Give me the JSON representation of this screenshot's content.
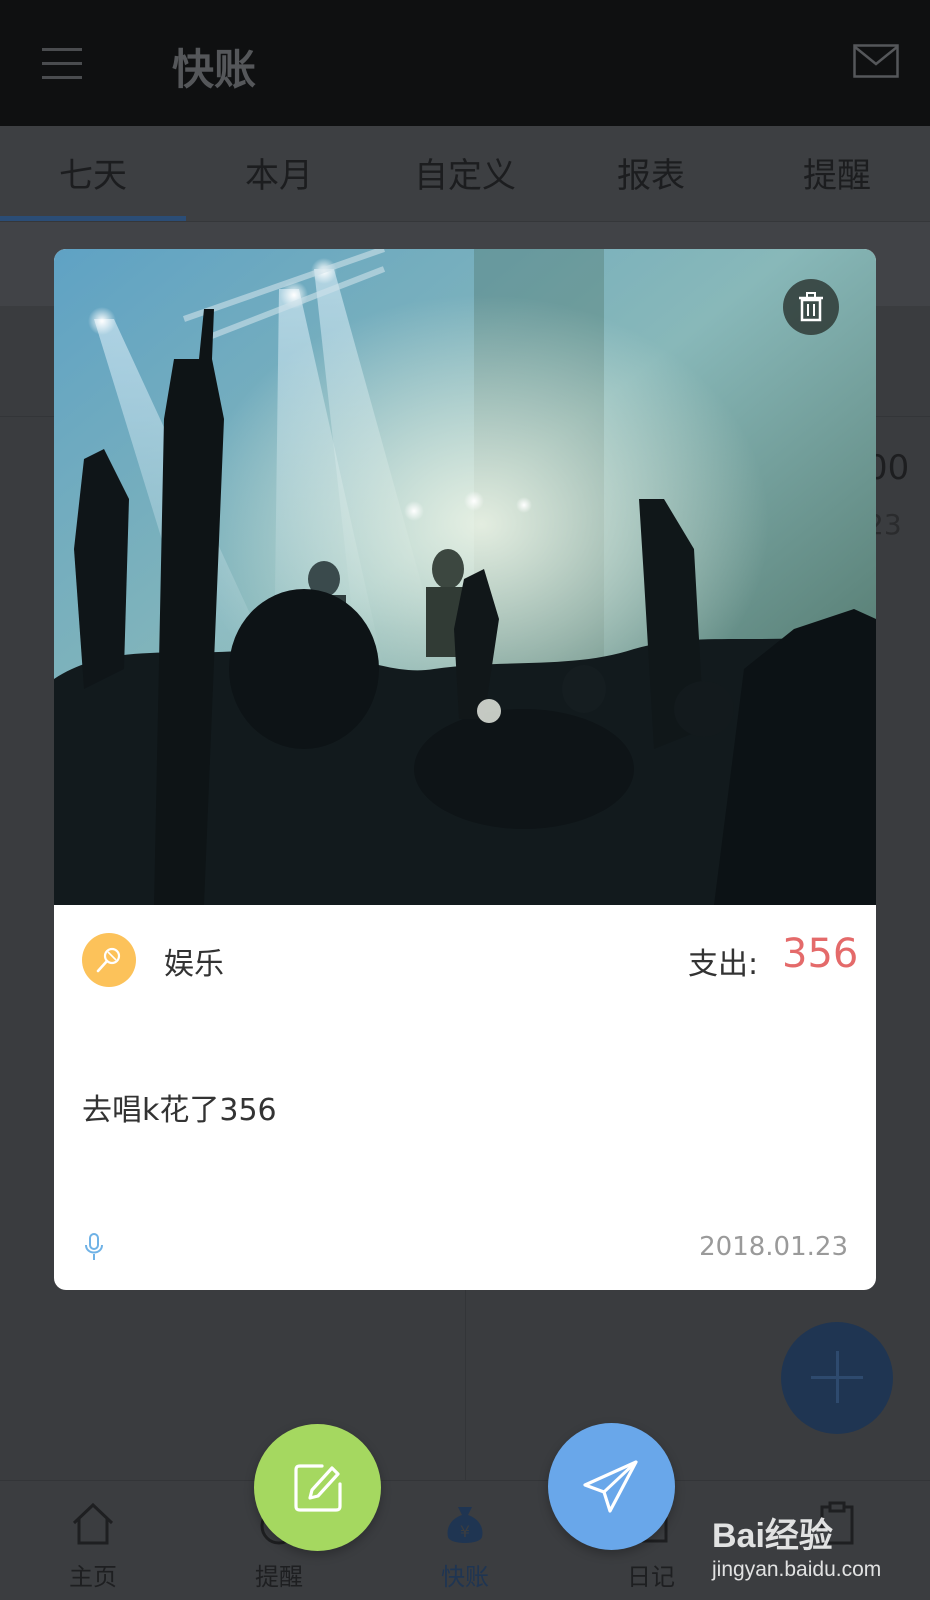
{
  "header": {
    "title": "快账",
    "menu_icon": "hamburger-menu-icon",
    "mail_icon": "mail-icon"
  },
  "tabs": [
    {
      "label": "七天",
      "active": true
    },
    {
      "label": "本月"
    },
    {
      "label": "自定义"
    },
    {
      "label": "报表"
    },
    {
      "label": "提醒"
    }
  ],
  "background_list": {
    "amount_peek": "00",
    "date_peek": "23"
  },
  "card": {
    "photo_description": "concert-crowd-photo",
    "category": {
      "name": "娱乐",
      "icon": "microphone-icon",
      "color": "#fcc25a"
    },
    "expense_label": "支出:",
    "expense_amount": "356",
    "expense_color": "#e46a6a",
    "memo": "去唱k花了356",
    "date": "2018.01.23",
    "voice_icon": "mic-icon",
    "delete_icon": "trash-icon"
  },
  "actions": {
    "edit_icon": "edit-icon",
    "send_icon": "paper-plane-icon"
  },
  "bottom_nav": [
    {
      "label": "主页",
      "icon": "home-icon"
    },
    {
      "label": "提醒",
      "icon": "alarm-icon"
    },
    {
      "label": "快账",
      "icon": "money-bag-icon",
      "active": true
    },
    {
      "label": "日记",
      "icon": "notebook-icon"
    },
    {
      "label": "",
      "icon": "clipboard-icon"
    }
  ],
  "watermark": {
    "logo": "Bai经验",
    "url": "jingyan.baidu.com"
  }
}
